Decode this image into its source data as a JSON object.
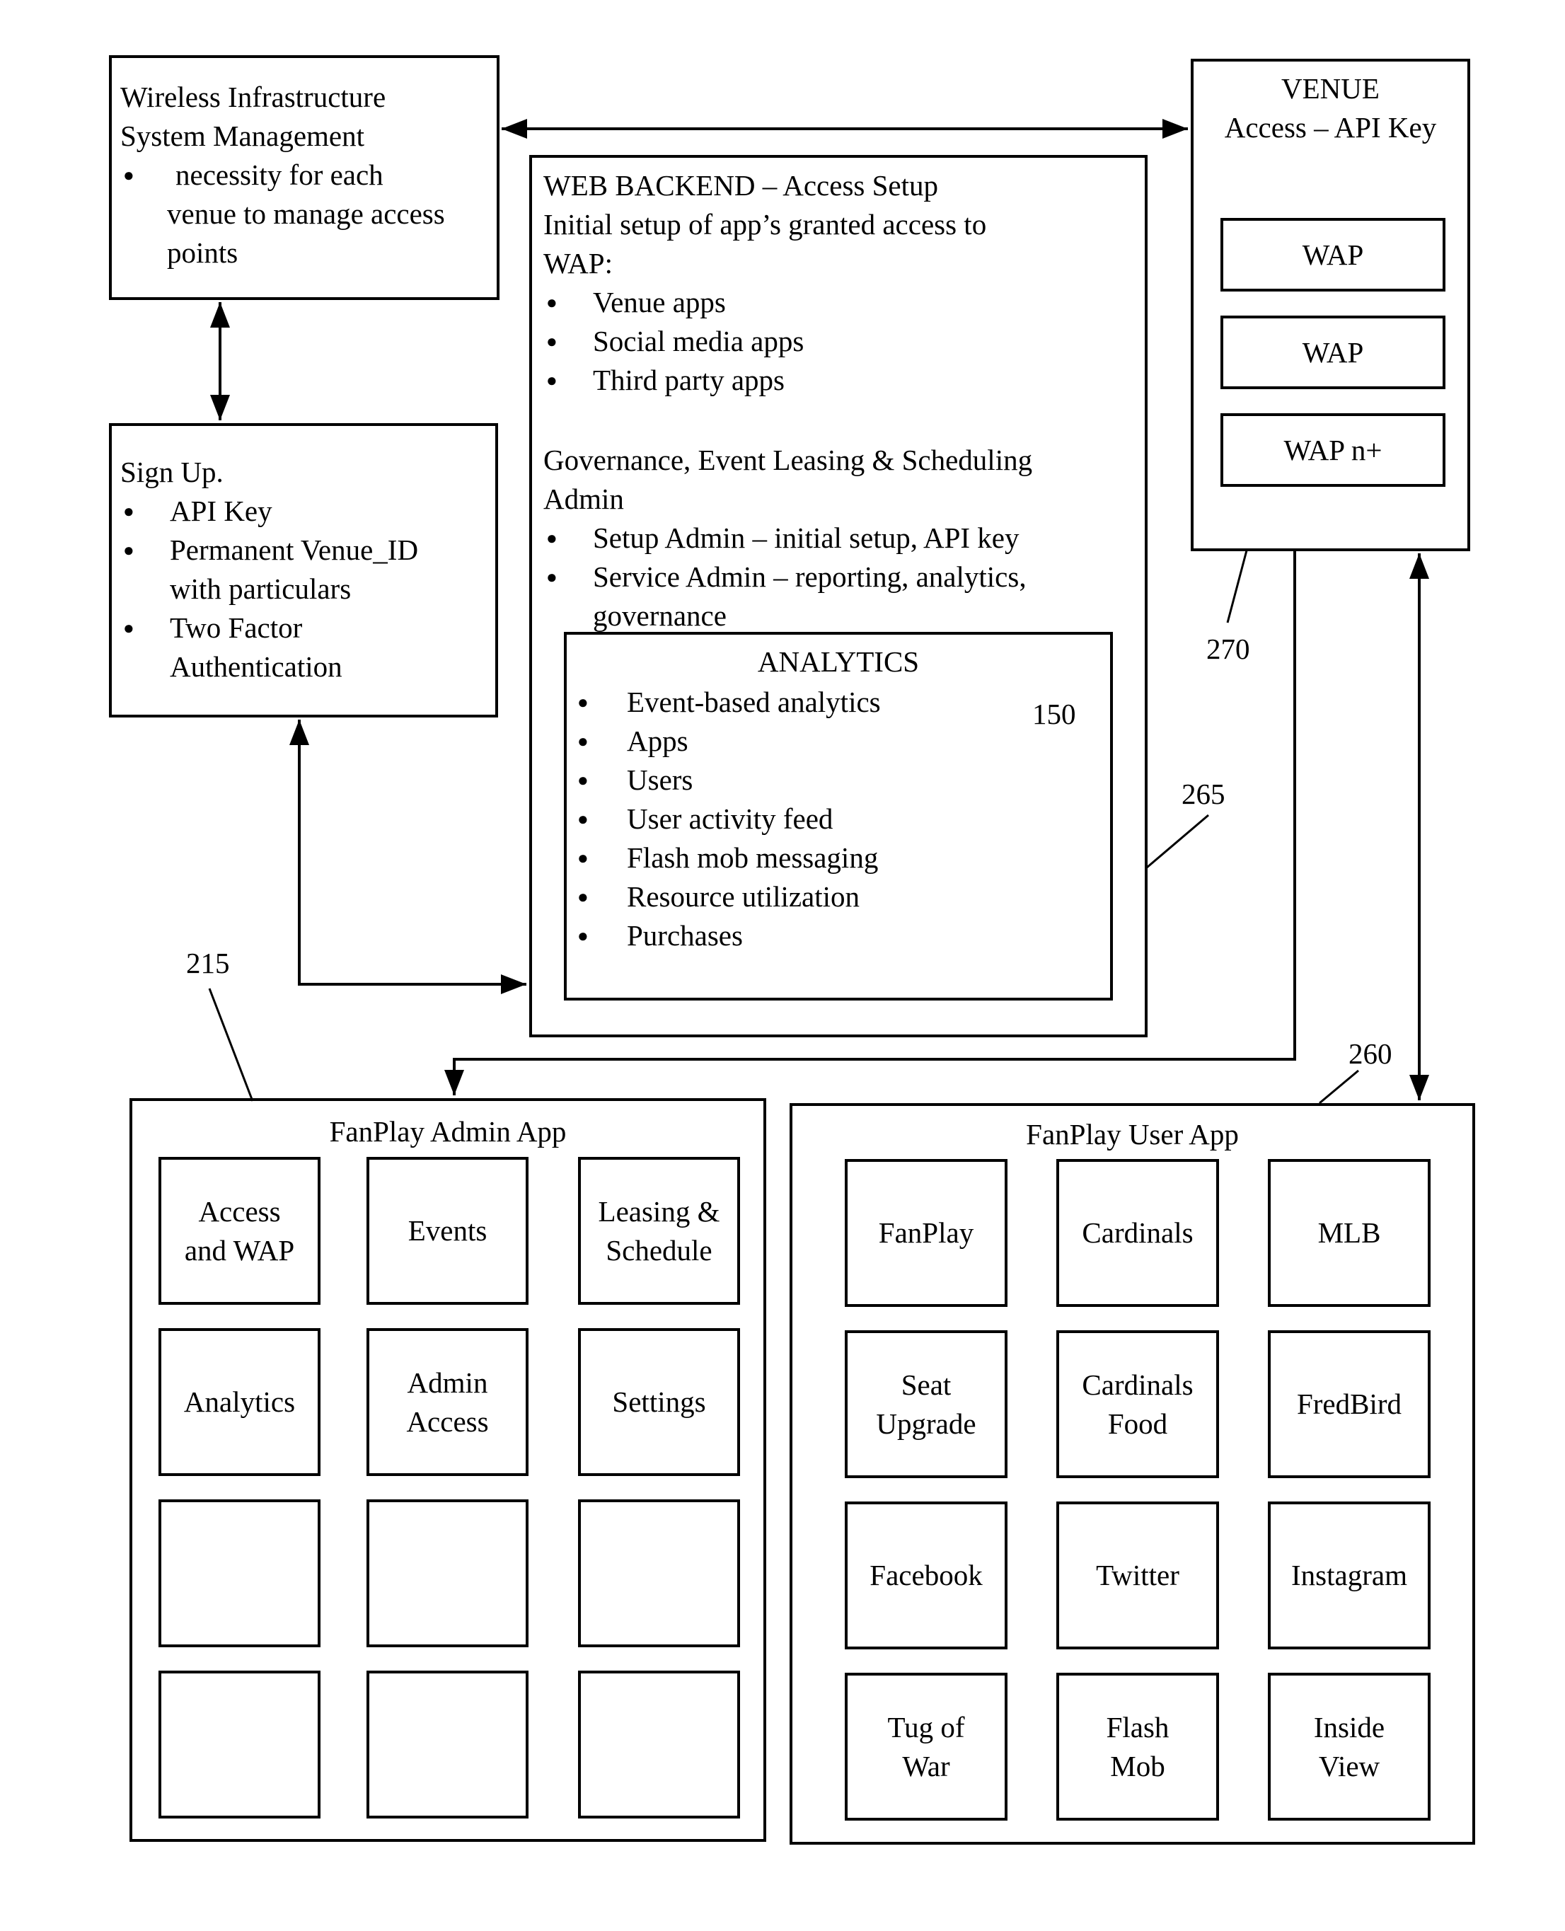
{
  "wireless_box": {
    "title_line1": "Wireless Infrastructure",
    "title_line2": "System Management",
    "bullets": [
      "necessity for each venue to manage access points"
    ],
    "bullet_lines": [
      "necessity for each",
      "venue to manage access",
      "points"
    ]
  },
  "signup_box": {
    "title": "Sign Up.",
    "bullets": [
      {
        "lines": [
          "API Key"
        ]
      },
      {
        "lines": [
          "Permanent Venue_ID",
          "with particulars"
        ]
      },
      {
        "lines": [
          "Two Factor",
          "Authentication"
        ]
      }
    ]
  },
  "web_backend": {
    "title": "WEB BACKEND – Access Setup",
    "subtitle_line1": "Initial setup of app’s granted access to",
    "subtitle_line2": "WAP:",
    "access_bullets": [
      "Venue apps",
      "Social media apps",
      "Third party apps"
    ],
    "governance_line1": "Governance, Event Leasing & Scheduling",
    "governance_line2": "Admin",
    "admin_bullets": [
      {
        "lines": [
          "Setup Admin – initial setup, API key"
        ]
      },
      {
        "lines": [
          "Service Admin – reporting, analytics,",
          "governance"
        ]
      }
    ],
    "ref_number": "265"
  },
  "analytics_box": {
    "title": "ANALYTICS",
    "ref_number": "150",
    "bullets": [
      "Event-based analytics",
      "Apps",
      "Users",
      "User activity feed",
      "Flash mob messaging",
      "Resource utilization",
      "Purchases"
    ]
  },
  "venue_box": {
    "title": "VENUE",
    "subtitle": "Access – API Key",
    "waps": [
      "WAP",
      "WAP",
      "WAP n+"
    ],
    "ref_number": "270"
  },
  "admin_app": {
    "title": "FanPlay Admin App",
    "ref_number": "215",
    "tiles": [
      "Access\nand WAP",
      "Events",
      "Leasing &\nSchedule",
      "Analytics",
      "Admin\nAccess",
      "Settings",
      "",
      "",
      "",
      "",
      "",
      ""
    ]
  },
  "user_app": {
    "title": "FanPlay User App",
    "ref_number": "260",
    "tiles": [
      "FanPlay",
      "Cardinals",
      "MLB",
      "Seat\nUpgrade",
      "Cardinals\nFood",
      "FredBird",
      "Facebook",
      "Twitter",
      "Instagram",
      "Tug of\nWar",
      "Flash\nMob",
      "Inside\nView"
    ]
  },
  "colors": {
    "line": "#000000",
    "background": "#ffffff"
  }
}
